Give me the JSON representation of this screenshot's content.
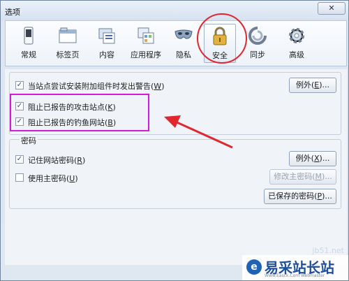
{
  "window": {
    "title": "选项",
    "close_label": "✕"
  },
  "toolbar": {
    "items": [
      {
        "label": "常规",
        "icon": "switch-icon"
      },
      {
        "label": "标签页",
        "icon": "tabs-icon"
      },
      {
        "label": "内容",
        "icon": "content-icon"
      },
      {
        "label": "应用程序",
        "icon": "applications-icon"
      },
      {
        "label": "隐私",
        "icon": "mask-icon"
      },
      {
        "label": "安全",
        "icon": "lock-icon"
      },
      {
        "label": "同步",
        "icon": "sync-icon"
      },
      {
        "label": "高级",
        "icon": "gear-icon"
      }
    ],
    "active": "安全"
  },
  "security": {
    "warn_addons": {
      "prefix": "当站点尝试安装附加组件时发出警告(",
      "key": "W",
      "suffix": ")",
      "checked": true
    },
    "exceptions1": {
      "prefix": "例外(",
      "key": "E",
      "suffix": ")..."
    },
    "block_attack": {
      "prefix": "阻止已报告的攻击站点(",
      "key": "K",
      "suffix": ")",
      "checked": true
    },
    "block_forgery": {
      "prefix": "阻止已报告的钓鱼网站(",
      "key": "B",
      "suffix": ")",
      "checked": true
    }
  },
  "passwords": {
    "group_title": "密码",
    "remember": {
      "prefix": "记住网站密码(",
      "key": "R",
      "suffix": ")",
      "checked": true
    },
    "exceptions2": {
      "prefix": "例外(",
      "key": "X",
      "suffix": ")..."
    },
    "master": {
      "prefix": "使用主密码(",
      "key": "U",
      "suffix": ")",
      "checked": false
    },
    "change_master": {
      "prefix": "修改主密码(",
      "key": "M",
      "suffix": ")..."
    },
    "saved": {
      "prefix": "已保存的密码(",
      "key": "P",
      "suffix": ")..."
    }
  },
  "watermark": {
    "logo_letter": "e",
    "brand": "易采站长站",
    "sub": "Www.Easck.Com Webmaster",
    "url": "jb51.net"
  },
  "colors": {
    "annotation_red": "#e0262e",
    "annotation_magenta": "#d51ad8"
  }
}
